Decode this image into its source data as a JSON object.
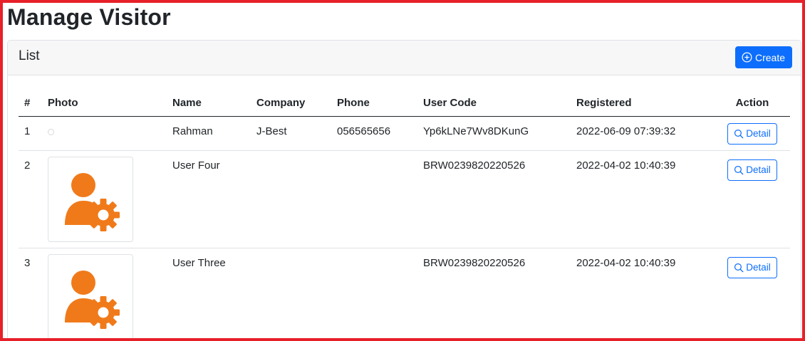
{
  "page": {
    "title": "Manage Visitor"
  },
  "card": {
    "title": "List",
    "create_label": "Create",
    "create_icon": "plus-circle-icon"
  },
  "table": {
    "headers": {
      "num": "#",
      "photo": "Photo",
      "name": "Name",
      "company": "Company",
      "phone": "Phone",
      "user_code": "User Code",
      "registered": "Registered",
      "action": "Action"
    },
    "rows": [
      {
        "num": "1",
        "photo": "empty",
        "name": "Rahman",
        "company": "J-Best",
        "phone": "056565656",
        "user_code": "Yp6kLNe7Wv8DKunG",
        "registered": "2022-06-09 07:39:32",
        "action": "Detail"
      },
      {
        "num": "2",
        "photo": "user-gear-icon",
        "name": "User Four",
        "company": "",
        "phone": "",
        "user_code": "BRW0239820220526",
        "registered": "2022-04-02 10:40:39",
        "action": "Detail"
      },
      {
        "num": "3",
        "photo": "user-gear-icon",
        "name": "User Three",
        "company": "",
        "phone": "",
        "user_code": "BRW0239820220526",
        "registered": "2022-04-02 10:40:39",
        "action": "Detail"
      }
    ]
  },
  "colors": {
    "primary": "#0d6efd",
    "avatar_orange": "#f07a1a",
    "frame_red": "#e8202a"
  }
}
